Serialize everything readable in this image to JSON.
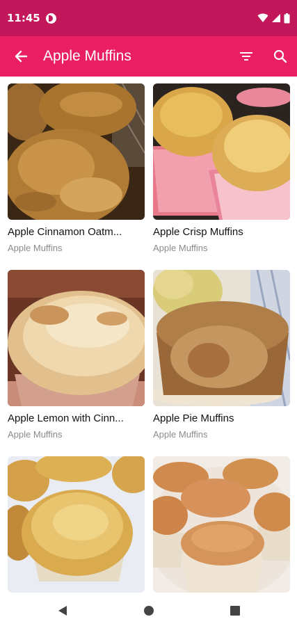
{
  "status_bar": {
    "time": "11:45",
    "icons": [
      "notification-badge-icon",
      "wifi-icon",
      "signal-icon",
      "battery-icon"
    ]
  },
  "app_bar": {
    "title": "Apple Muffins",
    "back_icon": "back-arrow-icon",
    "filter_icon": "filter-icon",
    "search_icon": "search-icon"
  },
  "recipes": [
    {
      "title": "Apple Cinnamon Oatm...",
      "category": "Apple Muffins"
    },
    {
      "title": "Apple Crisp Muffins",
      "category": "Apple Muffins"
    },
    {
      "title": "Apple Lemon with Cinn...",
      "category": "Apple Muffins"
    },
    {
      "title": "Apple Pie Muffins",
      "category": "Apple Muffins"
    },
    {
      "title": "",
      "category": ""
    },
    {
      "title": "",
      "category": ""
    }
  ],
  "nav_bar": {
    "back": "nav-back-icon",
    "home": "nav-home-icon",
    "recents": "nav-recents-icon"
  },
  "colors": {
    "status_bar": "#c2185b",
    "app_bar": "#e91e63",
    "subtitle": "#8a8a8a"
  }
}
